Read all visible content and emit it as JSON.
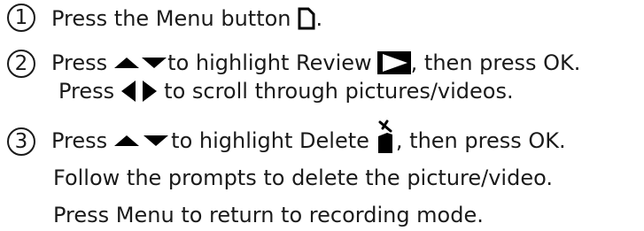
{
  "steps": [
    {
      "number": "1",
      "lines": [
        {
          "before": "Press the Menu button",
          "after": "."
        }
      ]
    },
    {
      "number": "2",
      "lines": [
        {
          "before": "Press",
          "middle": "to highlight Review",
          "after": ", then press OK."
        },
        {
          "before": "Press",
          "after": "to scroll through pictures/videos."
        }
      ]
    },
    {
      "number": "3",
      "lines": [
        {
          "before": "Press",
          "middle": "to highlight Delete",
          "after": ", then press OK."
        },
        {
          "text": "Follow the prompts to delete the picture/video."
        },
        {
          "text": "Press Menu to return to recording mode."
        }
      ]
    }
  ],
  "icons": {
    "menu": "menu-button-icon",
    "up_down": "up-down-arrows-icon",
    "left_right": "left-right-arrows-icon",
    "review": "review-play-icon",
    "delete": "delete-trash-icon"
  }
}
